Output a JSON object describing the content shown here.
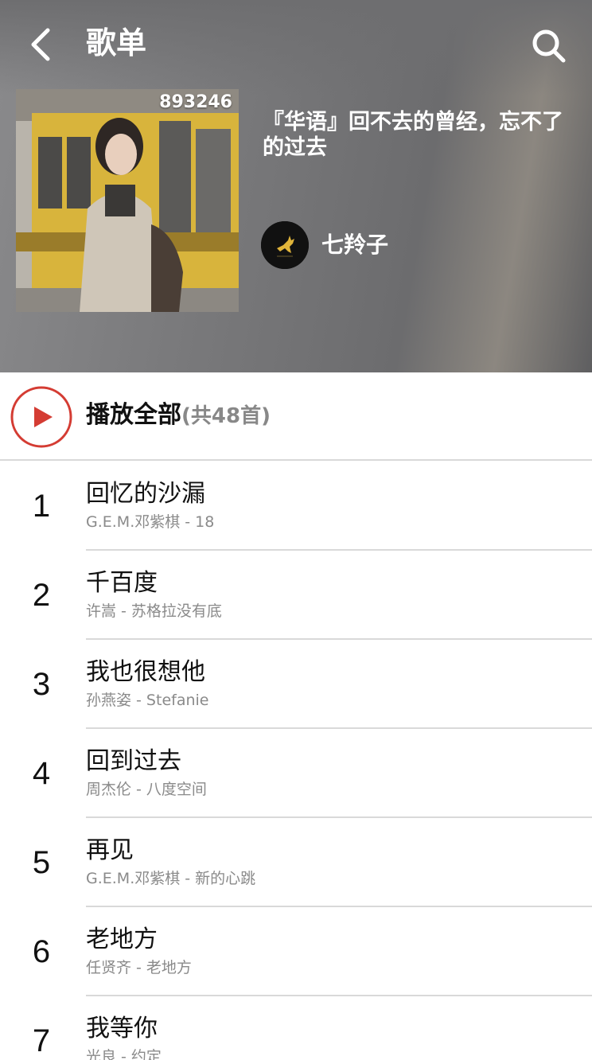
{
  "header": {
    "title": "歌单",
    "back_icon": "chevron-left-icon",
    "search_icon": "search-icon"
  },
  "playlist": {
    "play_count": "893246",
    "title": "『华语』回不去的曾经，忘不了的过去",
    "creator_name": "七羚子"
  },
  "play_all": {
    "label": "播放全部",
    "count": "(共48首)",
    "accent_color": "#d43c33"
  },
  "tracks": [
    {
      "index": "1",
      "title": "回忆的沙漏",
      "subtitle": "G.E.M.邓紫棋 - 18"
    },
    {
      "index": "2",
      "title": "千百度",
      "subtitle": "许嵩 - 苏格拉没有底"
    },
    {
      "index": "3",
      "title": "我也很想他",
      "subtitle": "孙燕姿 - Stefanie"
    },
    {
      "index": "4",
      "title": "回到过去",
      "subtitle": "周杰伦 - 八度空间"
    },
    {
      "index": "5",
      "title": "再见",
      "subtitle": "G.E.M.邓紫棋 - 新的心跳"
    },
    {
      "index": "6",
      "title": "老地方",
      "subtitle": "任贤齐 - 老地方"
    },
    {
      "index": "7",
      "title": "我等你",
      "subtitle": "光良 - 约定"
    }
  ]
}
